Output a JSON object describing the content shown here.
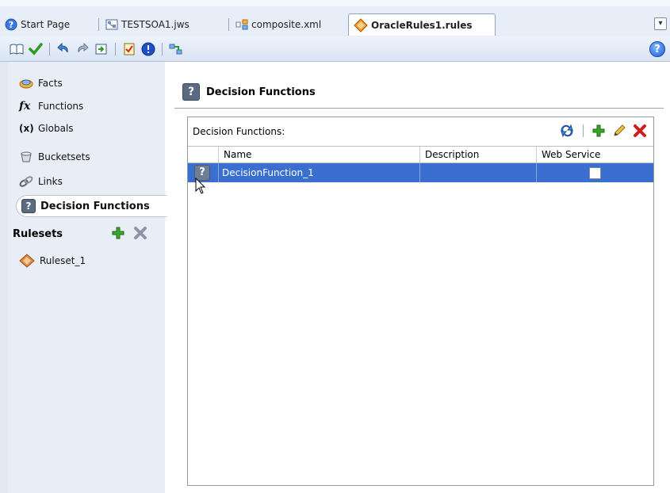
{
  "tabs": [
    {
      "label": "Start Page",
      "icon": "help-circle-icon"
    },
    {
      "label": "TESTSOA1.jws",
      "icon": "workspace-icon"
    },
    {
      "label": "composite.xml",
      "icon": "composite-icon"
    },
    {
      "label": "OracleRules1.rules",
      "icon": "rules-diamond-icon",
      "active": true
    }
  ],
  "toolbar": {
    "help_label": "?"
  },
  "nav": {
    "items": [
      {
        "label": "Facts",
        "icon": "facts-icon"
      },
      {
        "label": "Functions",
        "icon": "function-fx-icon",
        "glyph": "fx"
      },
      {
        "label": "Globals",
        "icon": "globals-icon",
        "glyph": "(x)"
      },
      {
        "label": "Bucketsets",
        "icon": "bucketsets-icon"
      },
      {
        "label": "Links",
        "icon": "links-icon"
      },
      {
        "label": "Decision Functions",
        "icon": "decision-function-icon",
        "selected": true
      }
    ],
    "rulesets_label": "Rulesets",
    "rulesets": [
      {
        "label": "Ruleset_1",
        "icon": "ruleset-icon"
      }
    ]
  },
  "main": {
    "title": "Decision Functions",
    "panel_label": "Decision Functions:",
    "columns": [
      "Name",
      "Description",
      "Web Service"
    ],
    "rows": [
      {
        "name": "DecisionFunction_1",
        "description": "",
        "web_service": false
      }
    ]
  },
  "icon_glyphs": {
    "question": "?",
    "menu": "▾"
  },
  "colors": {
    "selection": "#3a6fd0",
    "add": "#2e9a1e",
    "delete": "#d21c1c"
  }
}
